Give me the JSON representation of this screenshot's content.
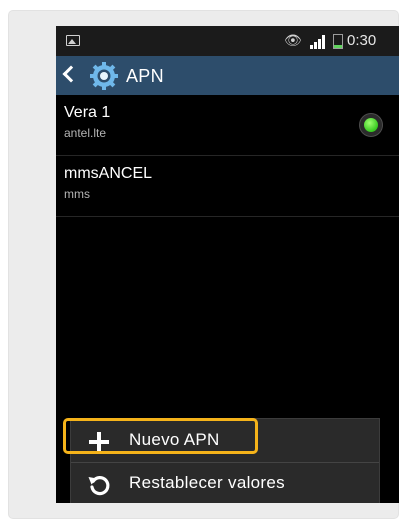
{
  "status_bar": {
    "time": "0:30",
    "icons": [
      "picture-icon",
      "eye-icon",
      "signal-icon",
      "battery-icon"
    ],
    "battery_color": "#5fd35c"
  },
  "action_bar": {
    "title": "APN",
    "background": "#2d4d6b",
    "icons": [
      "back-arrow-icon",
      "settings-gear-icon"
    ]
  },
  "apn_list": [
    {
      "name": "Vera 1",
      "apn": "antel.lte",
      "selected": true
    },
    {
      "name": "mmsANCEL",
      "apn": "mms",
      "selected": false
    }
  ],
  "menu": {
    "items": [
      {
        "label": "Nuevo APN",
        "icon": "plus-icon",
        "highlighted": true
      },
      {
        "label": "Restablecer valores",
        "icon": "reset-icon",
        "highlighted": false
      }
    ],
    "highlight_color": "#f5b31a"
  }
}
